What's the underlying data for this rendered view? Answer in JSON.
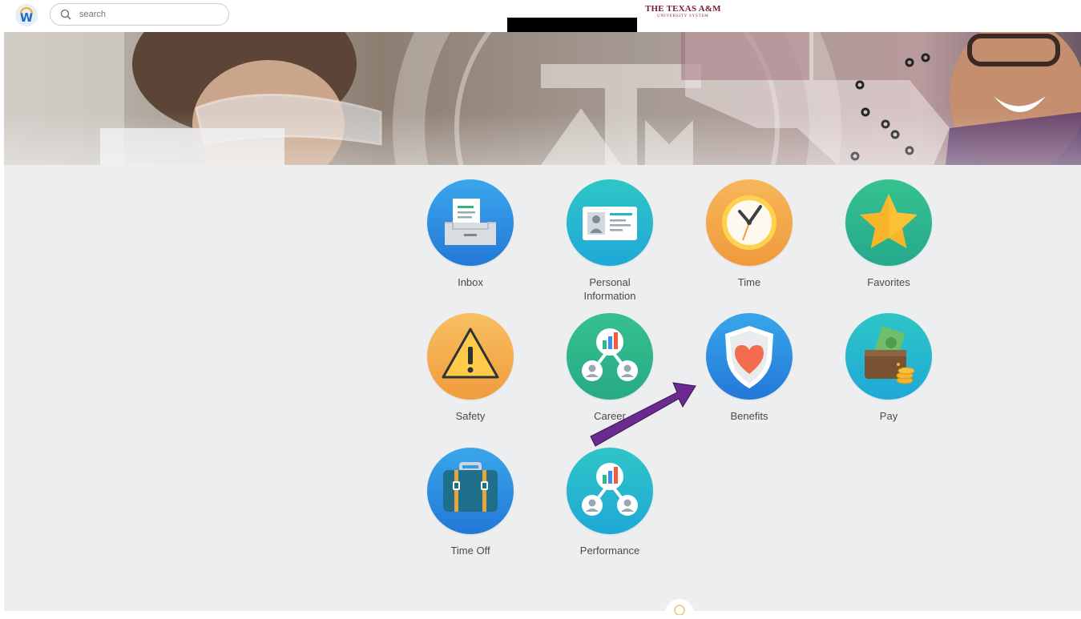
{
  "header": {
    "logo_letter": "W",
    "search": {
      "placeholder": "search"
    },
    "brand_line1": "THE TEXAS A&M",
    "brand_line2": "UNIVERSITY SYSTEM"
  },
  "apps": [
    {
      "id": "inbox",
      "label": "Inbox",
      "icon": "inbox-icon",
      "color": "#2f8fe0"
    },
    {
      "id": "personal-information",
      "label": "Personal Information",
      "icon": "id-card-icon",
      "color": "#22b5cf"
    },
    {
      "id": "time",
      "label": "Time",
      "icon": "clock-icon",
      "color": "#f3a64a"
    },
    {
      "id": "favorites",
      "label": "Favorites",
      "icon": "star-icon",
      "color": "#2db88f"
    },
    {
      "id": "safety",
      "label": "Safety",
      "icon": "warning-icon",
      "color": "#f3ad4c"
    },
    {
      "id": "career",
      "label": "Career",
      "icon": "org-chart-icon",
      "color": "#2ab58f"
    },
    {
      "id": "benefits",
      "label": "Benefits",
      "icon": "shield-heart-icon",
      "color": "#2a8fe2"
    },
    {
      "id": "pay",
      "label": "Pay",
      "icon": "wallet-icon",
      "color": "#25b3d3"
    },
    {
      "id": "time-off",
      "label": "Time Off",
      "icon": "suitcase-icon",
      "color": "#2f8fe0"
    },
    {
      "id": "performance",
      "label": "Performance",
      "icon": "org-chart-icon",
      "color": "#22b5cf"
    }
  ],
  "annotation": {
    "arrow_color": "#6b2a8f",
    "points_to": "benefits"
  }
}
